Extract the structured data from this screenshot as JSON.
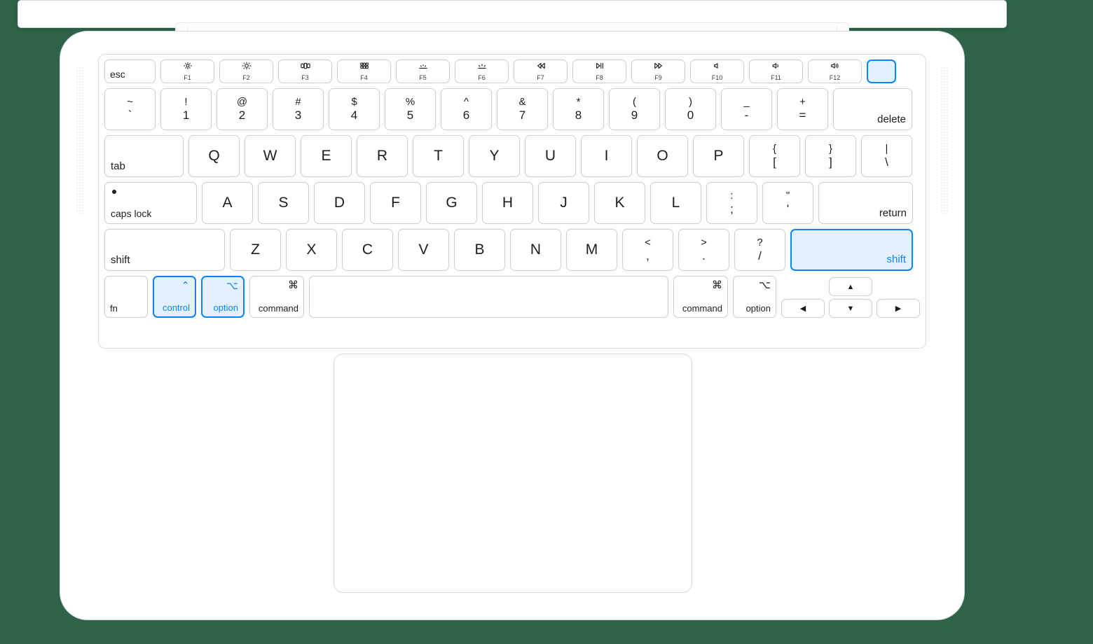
{
  "function_row": {
    "esc": "esc",
    "keys": [
      {
        "icon": "brightness-down-icon",
        "label": "F1"
      },
      {
        "icon": "brightness-up-icon",
        "label": "F2"
      },
      {
        "icon": "mission-control-icon",
        "label": "F3"
      },
      {
        "icon": "launchpad-icon",
        "label": "F4"
      },
      {
        "icon": "kbd-brightness-down-icon",
        "label": "F5"
      },
      {
        "icon": "kbd-brightness-up-icon",
        "label": "F6"
      },
      {
        "icon": "rewind-icon",
        "label": "F7"
      },
      {
        "icon": "play-pause-icon",
        "label": "F8"
      },
      {
        "icon": "forward-icon",
        "label": "F9"
      },
      {
        "icon": "mute-icon",
        "label": "F10"
      },
      {
        "icon": "volume-down-icon",
        "label": "F11"
      },
      {
        "icon": "volume-up-icon",
        "label": "F12"
      }
    ]
  },
  "row_numbers": {
    "keys": [
      {
        "top": "~",
        "bot": "`"
      },
      {
        "top": "!",
        "bot": "1"
      },
      {
        "top": "@",
        "bot": "2"
      },
      {
        "top": "#",
        "bot": "3"
      },
      {
        "top": "$",
        "bot": "4"
      },
      {
        "top": "%",
        "bot": "5"
      },
      {
        "top": "^",
        "bot": "6"
      },
      {
        "top": "&",
        "bot": "7"
      },
      {
        "top": "*",
        "bot": "8"
      },
      {
        "top": "(",
        "bot": "9"
      },
      {
        "top": ")",
        "bot": "0"
      },
      {
        "top": "_",
        "bot": "-"
      },
      {
        "top": "+",
        "bot": "="
      }
    ],
    "delete": "delete"
  },
  "row_qwerty": {
    "tab": "tab",
    "letters": [
      "Q",
      "W",
      "E",
      "R",
      "T",
      "Y",
      "U",
      "I",
      "O",
      "P"
    ],
    "brackets": [
      {
        "top": "{",
        "bot": "["
      },
      {
        "top": "}",
        "bot": "]"
      },
      {
        "top": "|",
        "bot": "\\"
      }
    ]
  },
  "row_asdf": {
    "caps": "caps lock",
    "letters": [
      "A",
      "S",
      "D",
      "F",
      "G",
      "H",
      "J",
      "K",
      "L"
    ],
    "punct": [
      {
        "top": ":",
        "bot": ";"
      },
      {
        "top": "\"",
        "bot": "'"
      }
    ],
    "return": "return"
  },
  "row_zxcv": {
    "lshift": "shift",
    "letters": [
      "Z",
      "X",
      "C",
      "V",
      "B",
      "N",
      "M"
    ],
    "punct": [
      {
        "top": "<",
        "bot": ","
      },
      {
        "top": ">",
        "bot": "."
      },
      {
        "top": "?",
        "bot": "/"
      }
    ],
    "rshift": "shift"
  },
  "row_bottom": {
    "fn": "fn",
    "control": {
      "sym": "⌃",
      "label": "control"
    },
    "option": {
      "sym": "⌥",
      "label": "option"
    },
    "command": {
      "sym": "⌘",
      "label": "command"
    },
    "arrows": {
      "up": "▲",
      "down": "▼",
      "left": "◀",
      "right": "▶"
    }
  },
  "highlighted_keys": [
    "touch-id",
    "right-shift",
    "left-control",
    "left-option"
  ]
}
